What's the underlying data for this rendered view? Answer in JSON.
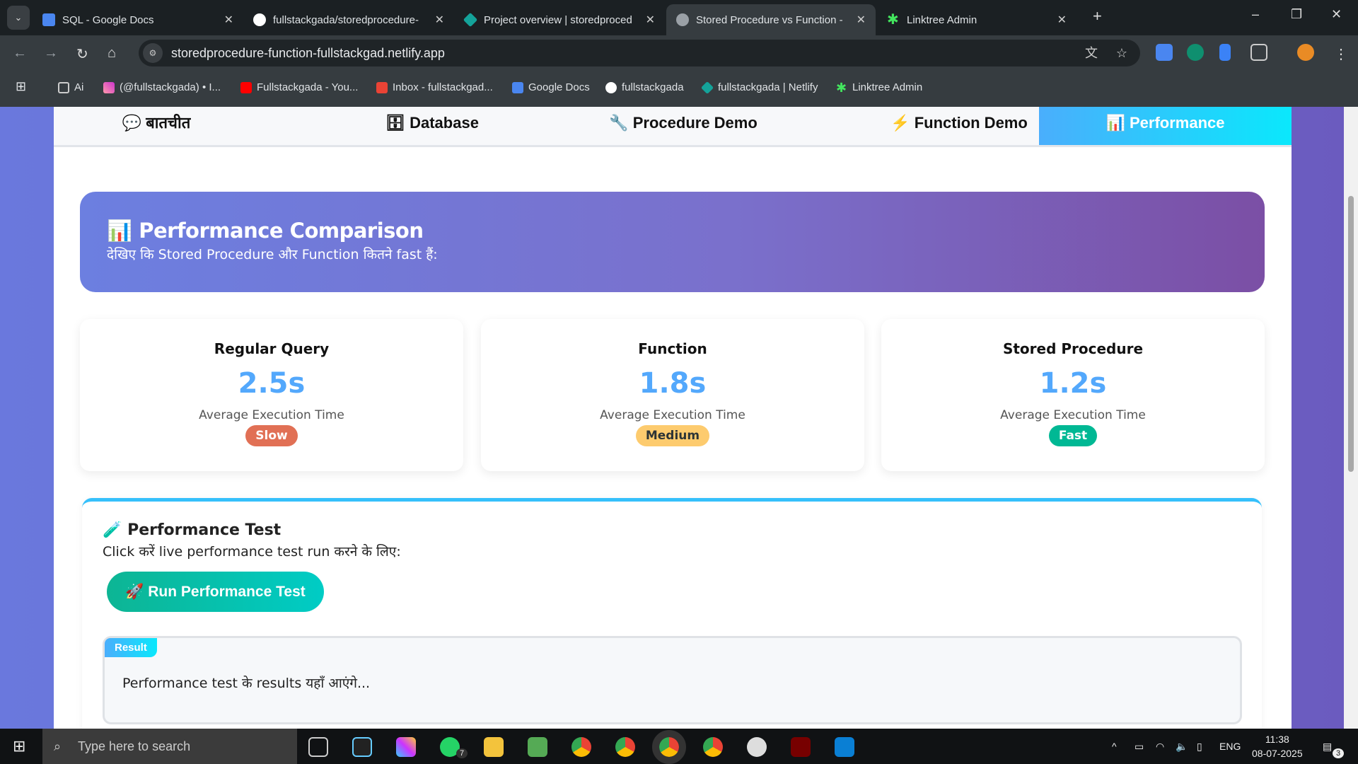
{
  "browser": {
    "tabs": [
      {
        "title": "SQL - Google Docs",
        "icon": "google-docs-icon",
        "color": "#4a86f0"
      },
      {
        "title": "fullstackgada/storedprocedure-",
        "icon": "github-icon",
        "color": "#ffffff"
      },
      {
        "title": "Project overview | storedproced",
        "icon": "netlify-icon",
        "color": "#14a39a"
      },
      {
        "title": "Stored Procedure vs Function -",
        "icon": "globe-icon",
        "color": "#9aa0a6",
        "active": true
      },
      {
        "title": "Linktree Admin",
        "icon": "linktree-icon",
        "color": "#43e55e"
      }
    ],
    "url": "storedprocedure-function-fullstackgad.netlify.app",
    "bookmarks": [
      {
        "label": "Ai",
        "icon": "folder-icon"
      },
      {
        "label": "(@fullstackgada) • I...",
        "icon": "instagram-icon"
      },
      {
        "label": "Fullstackgada - You...",
        "icon": "youtube-icon"
      },
      {
        "label": "Inbox - fullstackgad...",
        "icon": "gmail-icon"
      },
      {
        "label": "Google Docs",
        "icon": "google-docs-icon"
      },
      {
        "label": "fullstackgada",
        "icon": "github-icon"
      },
      {
        "label": "fullstackgada | Netlify",
        "icon": "netlify-icon"
      },
      {
        "label": "Linktree Admin",
        "icon": "linktree-icon"
      }
    ]
  },
  "nav": {
    "tabs": [
      {
        "icon": "💬",
        "label": "बातचीत"
      },
      {
        "icon": "🗄",
        "label": "Database"
      },
      {
        "icon": "🔧",
        "label": "Procedure Demo"
      },
      {
        "icon": "⚡",
        "label": "Function Demo"
      },
      {
        "icon": "📊",
        "label": "Performance",
        "active": true
      }
    ]
  },
  "hero": {
    "icon": "📊",
    "title": "Performance Comparison",
    "subtitle": "देखिए कि Stored Procedure और Function कितने fast हैं:"
  },
  "cards": [
    {
      "title": "Regular Query",
      "value": "2.5s",
      "label": "Average Execution Time",
      "badge": "Slow",
      "badge_color": "#e17055",
      "badge_text_color": "#ffffff"
    },
    {
      "title": "Function",
      "value": "1.8s",
      "label": "Average Execution Time",
      "badge": "Medium",
      "badge_color": "#fdcb6e",
      "badge_text_color": "#2d3436"
    },
    {
      "title": "Stored Procedure",
      "value": "1.2s",
      "label": "Average Execution Time",
      "badge": "Fast",
      "badge_color": "#00b894",
      "badge_text_color": "#ffffff"
    }
  ],
  "test": {
    "icon": "🧪",
    "title": "Performance Test",
    "desc": "Click करें live performance test run करने के लिए:",
    "button_icon": "🚀",
    "button": "Run Performance Test",
    "result_label": "Result",
    "result_text": "Performance test के results यहाँ आएंगे..."
  },
  "taskbar": {
    "search_placeholder": "Type here to search",
    "time": "11:38",
    "date": "08-07-2025",
    "lang": "ENG",
    "whatsapp_badge": "7",
    "notif_count": "3"
  }
}
